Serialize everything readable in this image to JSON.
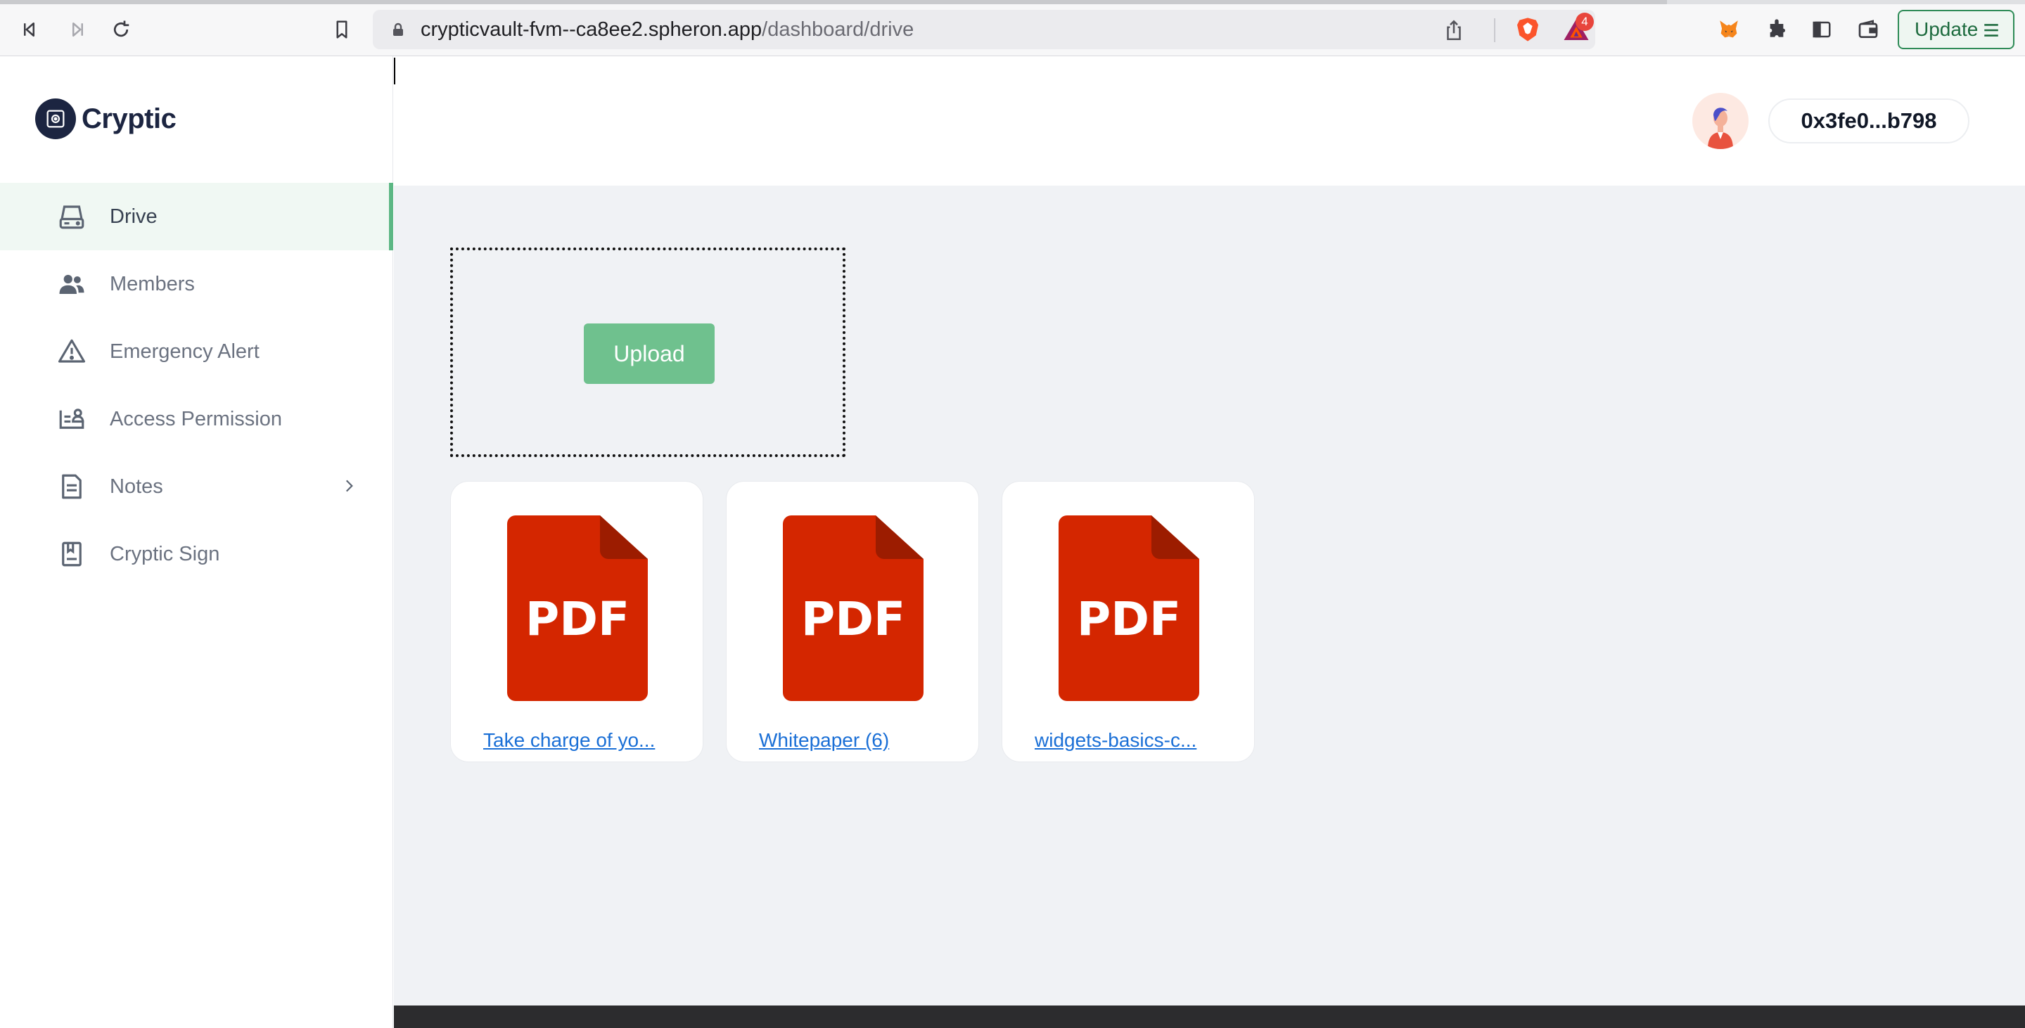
{
  "browser": {
    "url_host": "crypticvault-fvm--ca8ee2.spheron.app",
    "url_path": "/dashboard/drive",
    "notification_count": "4",
    "update_label": "Update"
  },
  "app": {
    "logo_text": "Cryptic",
    "wallet_address": "0x3fe0...b798",
    "upload_label": "Upload"
  },
  "sidebar": {
    "items": [
      {
        "label": "Drive",
        "icon": "drive-icon",
        "active": true
      },
      {
        "label": "Members",
        "icon": "members-icon"
      },
      {
        "label": "Emergency Alert",
        "icon": "alert-icon"
      },
      {
        "label": "Access Permission",
        "icon": "access-permission-icon"
      },
      {
        "label": "Notes",
        "icon": "notes-icon",
        "has_submenu": true
      },
      {
        "label": "Cryptic Sign",
        "icon": "sign-icon"
      }
    ]
  },
  "files": [
    {
      "name": "Take charge of yo...",
      "type": "PDF"
    },
    {
      "name": "Whitepaper (6)",
      "type": "PDF"
    },
    {
      "name": "widgets-basics-c...",
      "type": "PDF"
    }
  ],
  "colors": {
    "accent": "#5cb784",
    "upload_button": "#6fc18e",
    "pdf_red": "#d42600",
    "link": "#1a6fd6"
  }
}
